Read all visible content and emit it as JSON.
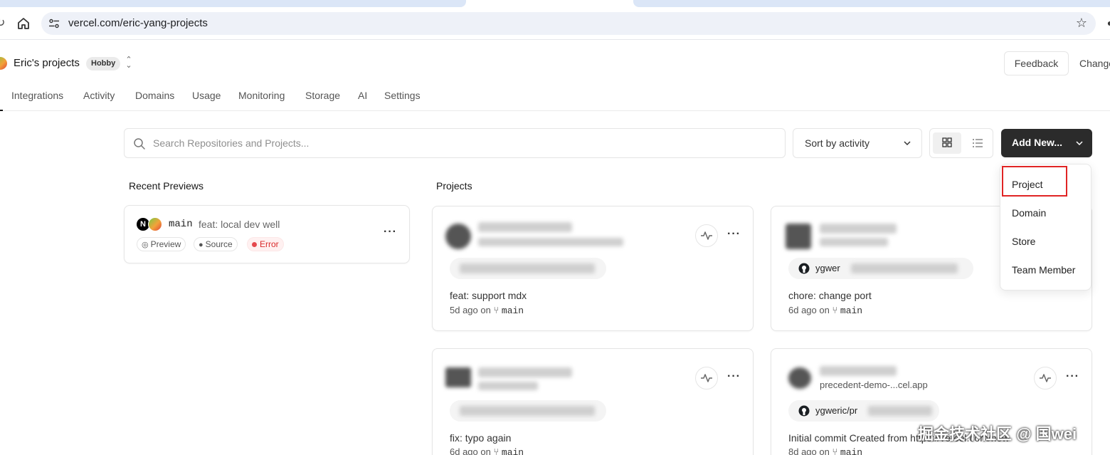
{
  "browser": {
    "url": "vercel.com/eric-yang-projects"
  },
  "header": {
    "team_name": "Eric's projects",
    "plan_badge": "Hobby",
    "feedback_label": "Feedback",
    "changelog_label": "Changelog"
  },
  "nav": {
    "tabs": [
      "Integrations",
      "Activity",
      "Domains",
      "Usage",
      "Monitoring",
      "Storage",
      "AI",
      "Settings"
    ]
  },
  "toolbar": {
    "search_placeholder": "Search Repositories and Projects...",
    "sort_label": "Sort by activity",
    "add_new_label": "Add New..."
  },
  "add_new_menu": {
    "items": [
      "Project",
      "Domain",
      "Store",
      "Team Member"
    ]
  },
  "recent_previews": {
    "title": "Recent Previews",
    "items": [
      {
        "avatar_letter": "N",
        "branch": "main",
        "commit": "feat: local dev well",
        "actions": [
          "Preview",
          "Source"
        ],
        "status": "Error"
      }
    ]
  },
  "projects": {
    "title": "Projects",
    "items": [
      {
        "repo": "",
        "commit": "feat: support mdx",
        "age": "5d ago on",
        "branch": "main"
      },
      {
        "repo": "ygwer",
        "commit": "chore: change port",
        "age": "6d ago on",
        "branch": "main"
      },
      {
        "repo": "",
        "commit": "fix: typo again",
        "age": "6d ago on",
        "branch": "main"
      },
      {
        "repo": "ygweric/pr",
        "url": "precedent-demo-...cel.app",
        "commit": "Initial commit Created from https://vercel.com/new",
        "age": "8d ago on",
        "branch": "main"
      }
    ]
  },
  "watermark": "掘金技术社区 @ 国wei",
  "colors": {
    "accent_dark": "#2b2b2b",
    "error": "#e5484d",
    "highlight": "#e02424"
  }
}
